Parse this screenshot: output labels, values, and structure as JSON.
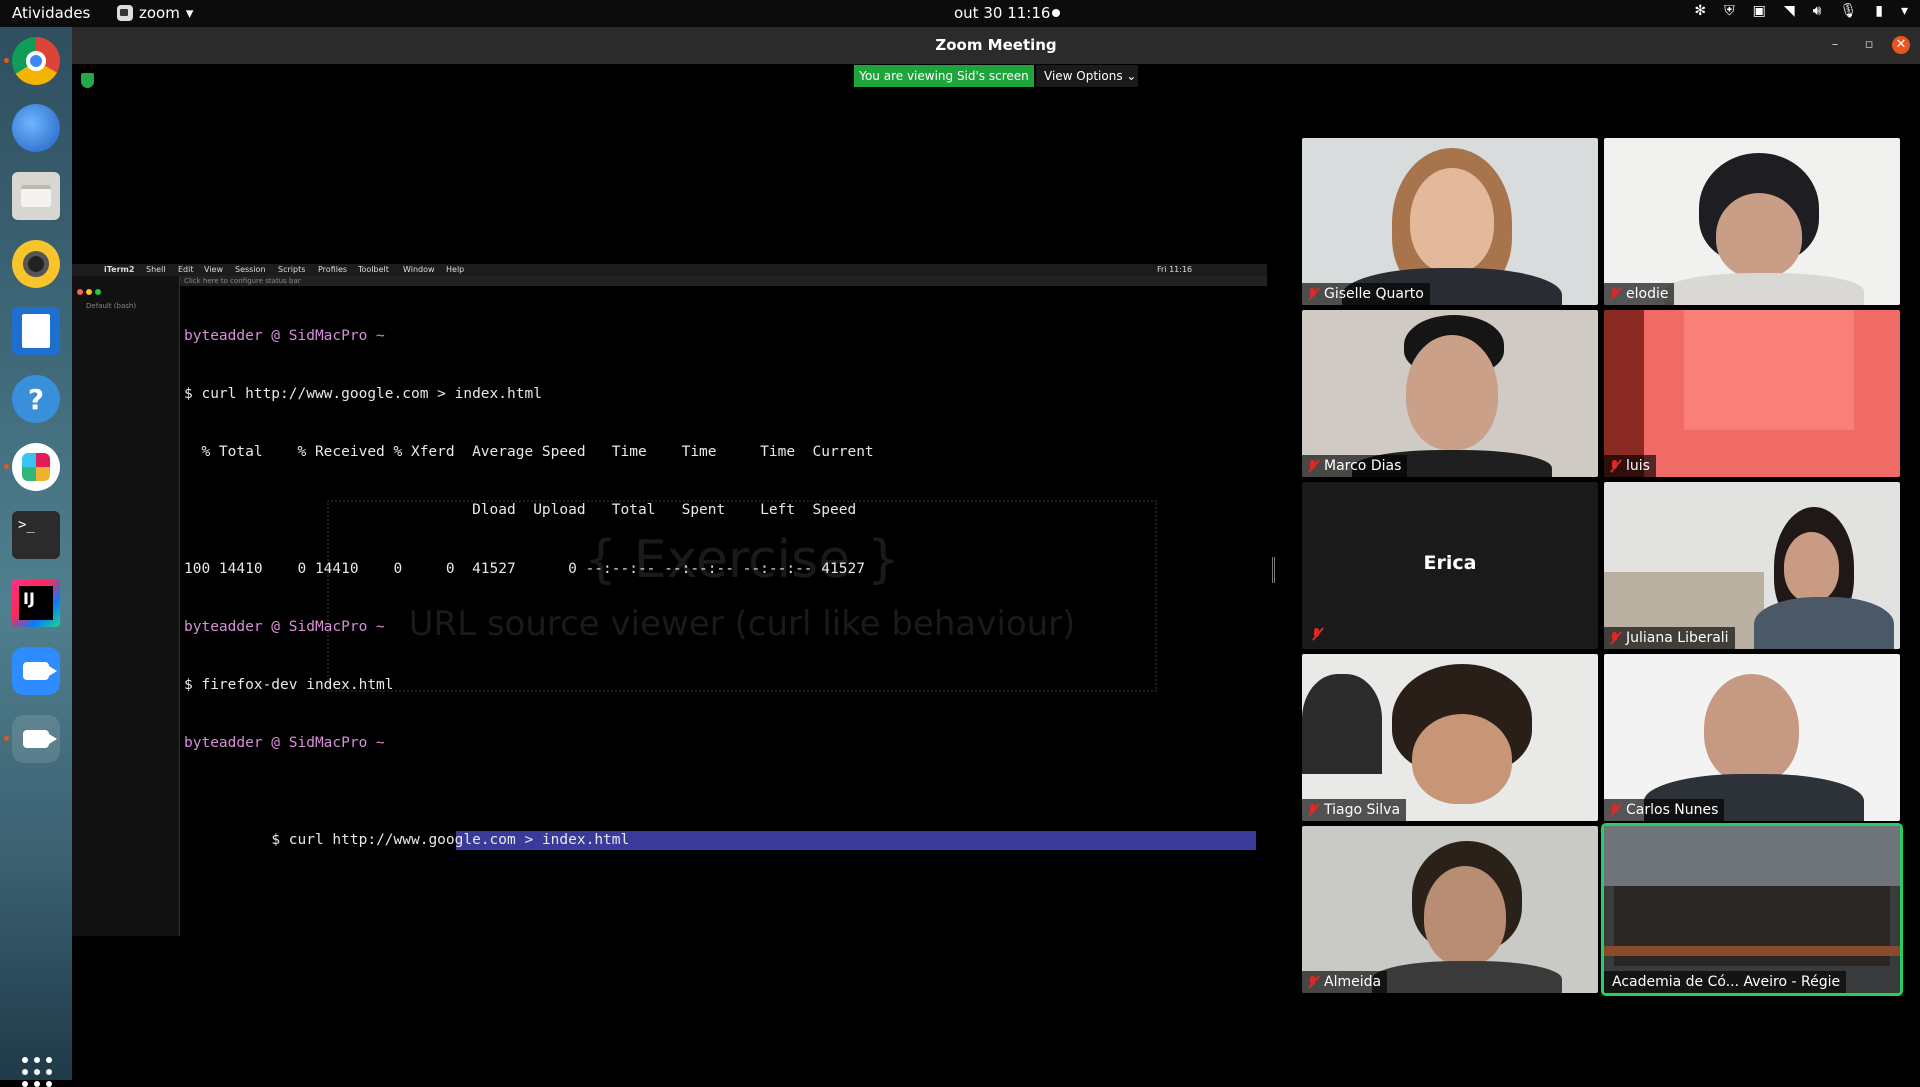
{
  "topbar": {
    "activities": "Atividades",
    "app_name": "zoom",
    "datetime": "out 30  11:16"
  },
  "window": {
    "title": "Zoom Meeting"
  },
  "share": {
    "viewing_label": "You are viewing Sid's screen",
    "view_options_label": "View Options"
  },
  "mac": {
    "menu": [
      "iTerm2",
      "Shell",
      "Edit",
      "View",
      "Session",
      "Scripts",
      "Profiles",
      "Toolbelt",
      "Window",
      "Help"
    ],
    "menu_right": "Fri 11:16",
    "status_hint": "Click here to configure status bar",
    "sidebar_profile": "Default (bash)",
    "terminal": {
      "prompt1": "byteadder @ SidMacPro ~",
      "cmd1": "$ curl http://www.google.com > index.html",
      "hdr1": "  % Total    % Received % Xferd  Average Speed   Time    Time     Time  Current",
      "hdr2": "                                 Dload  Upload   Total   Spent    Left  Speed",
      "row1": "100 14410    0 14410    0     0  41527      0 --:--:-- --:--:-- --:--:-- 41527",
      "prompt2": "byteadder @ SidMacPro ~",
      "cmd2": "$ firefox-dev index.html",
      "prompt3": "byteadder @ SidMacPro ~",
      "cmd3_prefix": "$ curl http://www.google.com > ",
      "cmd3_selected": "index.html"
    },
    "watermark_title": "{ Exercise }",
    "watermark_sub": "URL source viewer (curl like behaviour)"
  },
  "participants": [
    {
      "name": "Giselle Quarto",
      "muted": true
    },
    {
      "name": "elodie",
      "muted": true
    },
    {
      "name": "Marco Dias",
      "muted": true
    },
    {
      "name": "luis",
      "muted": true
    },
    {
      "name": "Erica",
      "muted": true
    },
    {
      "name": "Juliana Liberali",
      "muted": true
    },
    {
      "name": "Tiago Silva",
      "muted": true
    },
    {
      "name": "Carlos Nunes",
      "muted": true
    },
    {
      "name": "Almeida",
      "muted": true
    },
    {
      "name": "Academia de Có... Aveiro - Régie",
      "muted": false
    }
  ],
  "colors": {
    "viewing_banner": "#1fa33b",
    "active_speaker": "#23d160",
    "close_button": "#e95420"
  }
}
